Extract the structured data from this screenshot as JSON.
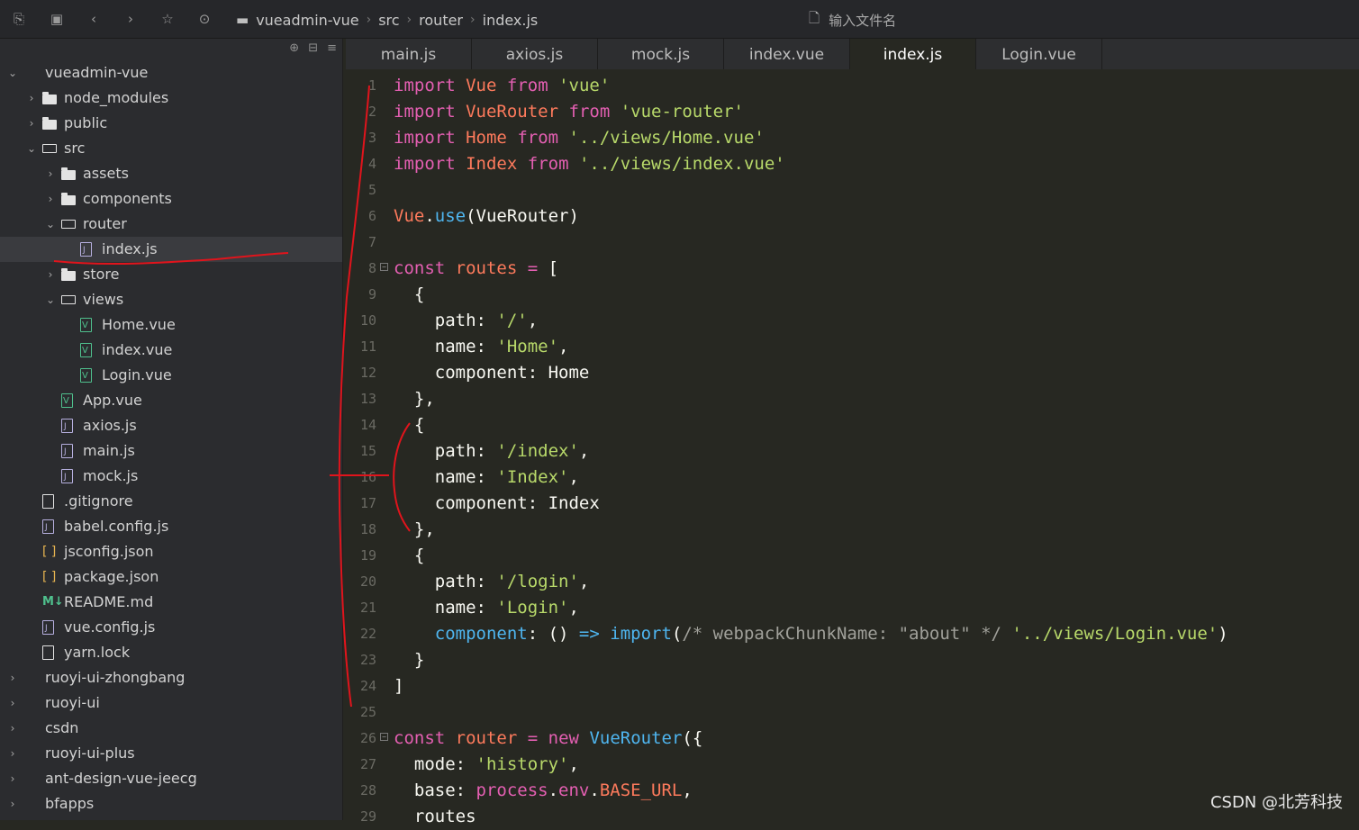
{
  "toolbar": {
    "breadcrumb": [
      "vueadmin-vue",
      "src",
      "router",
      "index.js"
    ],
    "file_search_placeholder": "输入文件名"
  },
  "sidebar": {
    "tree": [
      {
        "label": "vueadmin-vue",
        "type": "project",
        "depth": 0,
        "chevron": "open"
      },
      {
        "label": "node_modules",
        "type": "folder",
        "depth": 1,
        "chevron": "closed"
      },
      {
        "label": "public",
        "type": "folder",
        "depth": 1,
        "chevron": "closed"
      },
      {
        "label": "src",
        "type": "folder-open",
        "depth": 1,
        "chevron": "open"
      },
      {
        "label": "assets",
        "type": "folder",
        "depth": 2,
        "chevron": "closed"
      },
      {
        "label": "components",
        "type": "folder",
        "depth": 2,
        "chevron": "closed"
      },
      {
        "label": "router",
        "type": "folder-open",
        "depth": 2,
        "chevron": "open"
      },
      {
        "label": "index.js",
        "type": "js",
        "depth": 3,
        "chevron": "",
        "selected": true
      },
      {
        "label": "store",
        "type": "folder",
        "depth": 2,
        "chevron": "closed"
      },
      {
        "label": "views",
        "type": "folder-open",
        "depth": 2,
        "chevron": "open"
      },
      {
        "label": "Home.vue",
        "type": "vue",
        "depth": 3,
        "chevron": ""
      },
      {
        "label": "index.vue",
        "type": "vue",
        "depth": 3,
        "chevron": ""
      },
      {
        "label": "Login.vue",
        "type": "vue",
        "depth": 3,
        "chevron": ""
      },
      {
        "label": "App.vue",
        "type": "vue",
        "depth": 2,
        "chevron": ""
      },
      {
        "label": "axios.js",
        "type": "js",
        "depth": 2,
        "chevron": ""
      },
      {
        "label": "main.js",
        "type": "js",
        "depth": 2,
        "chevron": ""
      },
      {
        "label": "mock.js",
        "type": "js",
        "depth": 2,
        "chevron": ""
      },
      {
        "label": ".gitignore",
        "type": "plain",
        "depth": 1,
        "chevron": ""
      },
      {
        "label": "babel.config.js",
        "type": "js",
        "depth": 1,
        "chevron": ""
      },
      {
        "label": "jsconfig.json",
        "type": "json",
        "depth": 1,
        "chevron": ""
      },
      {
        "label": "package.json",
        "type": "json",
        "depth": 1,
        "chevron": ""
      },
      {
        "label": "README.md",
        "type": "md",
        "depth": 1,
        "chevron": ""
      },
      {
        "label": "vue.config.js",
        "type": "js",
        "depth": 1,
        "chevron": ""
      },
      {
        "label": "yarn.lock",
        "type": "plain",
        "depth": 1,
        "chevron": ""
      },
      {
        "label": "ruoyi-ui-zhongbang",
        "type": "project",
        "depth": 0,
        "chevron": "closed"
      },
      {
        "label": "ruoyi-ui",
        "type": "project",
        "depth": 0,
        "chevron": "closed"
      },
      {
        "label": "csdn",
        "type": "project",
        "depth": 0,
        "chevron": "closed"
      },
      {
        "label": "ruoyi-ui-plus",
        "type": "project",
        "depth": 0,
        "chevron": "closed"
      },
      {
        "label": "ant-design-vue-jeecg",
        "type": "project",
        "depth": 0,
        "chevron": "closed"
      },
      {
        "label": "bfapps",
        "type": "project",
        "depth": 0,
        "chevron": "closed"
      }
    ]
  },
  "tabs": [
    {
      "label": "main.js",
      "active": false
    },
    {
      "label": "axios.js",
      "active": false
    },
    {
      "label": "mock.js",
      "active": false
    },
    {
      "label": "index.vue",
      "active": false
    },
    {
      "label": "index.js",
      "active": true
    },
    {
      "label": "Login.vue",
      "active": false
    }
  ],
  "code_lines": [
    {
      "n": "1",
      "fold": false,
      "tokens": [
        [
          "kw",
          "import"
        ],
        [
          "p",
          " "
        ],
        [
          "cls",
          "Vue"
        ],
        [
          "p",
          " "
        ],
        [
          "kw",
          "from"
        ],
        [
          "p",
          " "
        ],
        [
          "str",
          "'vue'"
        ]
      ]
    },
    {
      "n": "2",
      "fold": false,
      "tokens": [
        [
          "kw",
          "import"
        ],
        [
          "p",
          " "
        ],
        [
          "cls",
          "VueRouter"
        ],
        [
          "p",
          " "
        ],
        [
          "kw",
          "from"
        ],
        [
          "p",
          " "
        ],
        [
          "str",
          "'vue-router'"
        ]
      ]
    },
    {
      "n": "3",
      "fold": false,
      "tokens": [
        [
          "kw",
          "import"
        ],
        [
          "p",
          " "
        ],
        [
          "cls",
          "Home"
        ],
        [
          "p",
          " "
        ],
        [
          "kw",
          "from"
        ],
        [
          "p",
          " "
        ],
        [
          "str",
          "'../views/Home.vue'"
        ]
      ]
    },
    {
      "n": "4",
      "fold": false,
      "tokens": [
        [
          "kw",
          "import"
        ],
        [
          "p",
          " "
        ],
        [
          "cls",
          "Index"
        ],
        [
          "p",
          " "
        ],
        [
          "kw",
          "from"
        ],
        [
          "p",
          " "
        ],
        [
          "str",
          "'../views/index.vue'"
        ]
      ]
    },
    {
      "n": "5",
      "fold": false,
      "tokens": []
    },
    {
      "n": "6",
      "fold": false,
      "tokens": [
        [
          "cls",
          "Vue"
        ],
        [
          "p",
          "."
        ],
        [
          "fn",
          "use"
        ],
        [
          "p",
          "(VueRouter)"
        ]
      ]
    },
    {
      "n": "7",
      "fold": false,
      "tokens": []
    },
    {
      "n": "8",
      "fold": true,
      "tokens": [
        [
          "kw",
          "const"
        ],
        [
          "p",
          " "
        ],
        [
          "cls",
          "routes"
        ],
        [
          "p",
          " "
        ],
        [
          "kw",
          "="
        ],
        [
          "p",
          " ["
        ]
      ]
    },
    {
      "n": "9",
      "fold": false,
      "tokens": [
        [
          "p",
          "  {"
        ]
      ]
    },
    {
      "n": "10",
      "fold": false,
      "tokens": [
        [
          "p",
          "    path: "
        ],
        [
          "str",
          "'/'"
        ],
        [
          "p",
          ","
        ]
      ]
    },
    {
      "n": "11",
      "fold": false,
      "tokens": [
        [
          "p",
          "    name: "
        ],
        [
          "str",
          "'Home'"
        ],
        [
          "p",
          ","
        ]
      ]
    },
    {
      "n": "12",
      "fold": false,
      "tokens": [
        [
          "p",
          "    component: Home"
        ]
      ]
    },
    {
      "n": "13",
      "fold": false,
      "tokens": [
        [
          "p",
          "  },"
        ]
      ]
    },
    {
      "n": "14",
      "fold": false,
      "tokens": [
        [
          "p",
          "  {"
        ]
      ]
    },
    {
      "n": "15",
      "fold": false,
      "tokens": [
        [
          "p",
          "    path: "
        ],
        [
          "str",
          "'/index'"
        ],
        [
          "p",
          ","
        ]
      ]
    },
    {
      "n": "16",
      "fold": false,
      "tokens": [
        [
          "p",
          "    name: "
        ],
        [
          "str",
          "'Index'"
        ],
        [
          "p",
          ","
        ]
      ]
    },
    {
      "n": "17",
      "fold": false,
      "tokens": [
        [
          "p",
          "    component: Index"
        ]
      ]
    },
    {
      "n": "18",
      "fold": false,
      "tokens": [
        [
          "p",
          "  },"
        ]
      ]
    },
    {
      "n": "19",
      "fold": false,
      "tokens": [
        [
          "p",
          "  {"
        ]
      ]
    },
    {
      "n": "20",
      "fold": false,
      "tokens": [
        [
          "p",
          "    path: "
        ],
        [
          "str",
          "'/login'"
        ],
        [
          "p",
          ","
        ]
      ]
    },
    {
      "n": "21",
      "fold": false,
      "tokens": [
        [
          "p",
          "    name: "
        ],
        [
          "str",
          "'Login'"
        ],
        [
          "p",
          ","
        ]
      ]
    },
    {
      "n": "22",
      "fold": false,
      "tokens": [
        [
          "p",
          "    "
        ],
        [
          "fn",
          "component"
        ],
        [
          "p",
          ": () "
        ],
        [
          "fn",
          "=>"
        ],
        [
          "p",
          " "
        ],
        [
          "fn",
          "import"
        ],
        [
          "p",
          "("
        ],
        [
          "cm",
          "/* webpackChunkName: \"about\" */"
        ],
        [
          "p",
          " "
        ],
        [
          "str",
          "'../views/Login.vue'"
        ],
        [
          "p",
          ")"
        ]
      ]
    },
    {
      "n": "23",
      "fold": false,
      "tokens": [
        [
          "p",
          "  }"
        ]
      ]
    },
    {
      "n": "24",
      "fold": false,
      "tokens": [
        [
          "p",
          "]"
        ]
      ]
    },
    {
      "n": "25",
      "fold": false,
      "tokens": []
    },
    {
      "n": "26",
      "fold": true,
      "tokens": [
        [
          "kw",
          "const"
        ],
        [
          "p",
          " "
        ],
        [
          "cls",
          "router"
        ],
        [
          "p",
          " "
        ],
        [
          "kw",
          "="
        ],
        [
          "p",
          " "
        ],
        [
          "kw",
          "new"
        ],
        [
          "p",
          " "
        ],
        [
          "fn",
          "VueRouter"
        ],
        [
          "p",
          "({"
        ]
      ]
    },
    {
      "n": "27",
      "fold": false,
      "tokens": [
        [
          "p",
          "  mode: "
        ],
        [
          "str",
          "'history'"
        ],
        [
          "p",
          ","
        ]
      ]
    },
    {
      "n": "28",
      "fold": false,
      "tokens": [
        [
          "p",
          "  base: "
        ],
        [
          "kw",
          "process"
        ],
        [
          "p",
          "."
        ],
        [
          "kw",
          "env"
        ],
        [
          "p",
          "."
        ],
        [
          "cls",
          "BASE_URL"
        ],
        [
          "p",
          ","
        ]
      ]
    },
    {
      "n": "29",
      "fold": false,
      "tokens": [
        [
          "p",
          "  routes"
        ]
      ]
    }
  ],
  "watermark": "CSDN @北芳科技"
}
